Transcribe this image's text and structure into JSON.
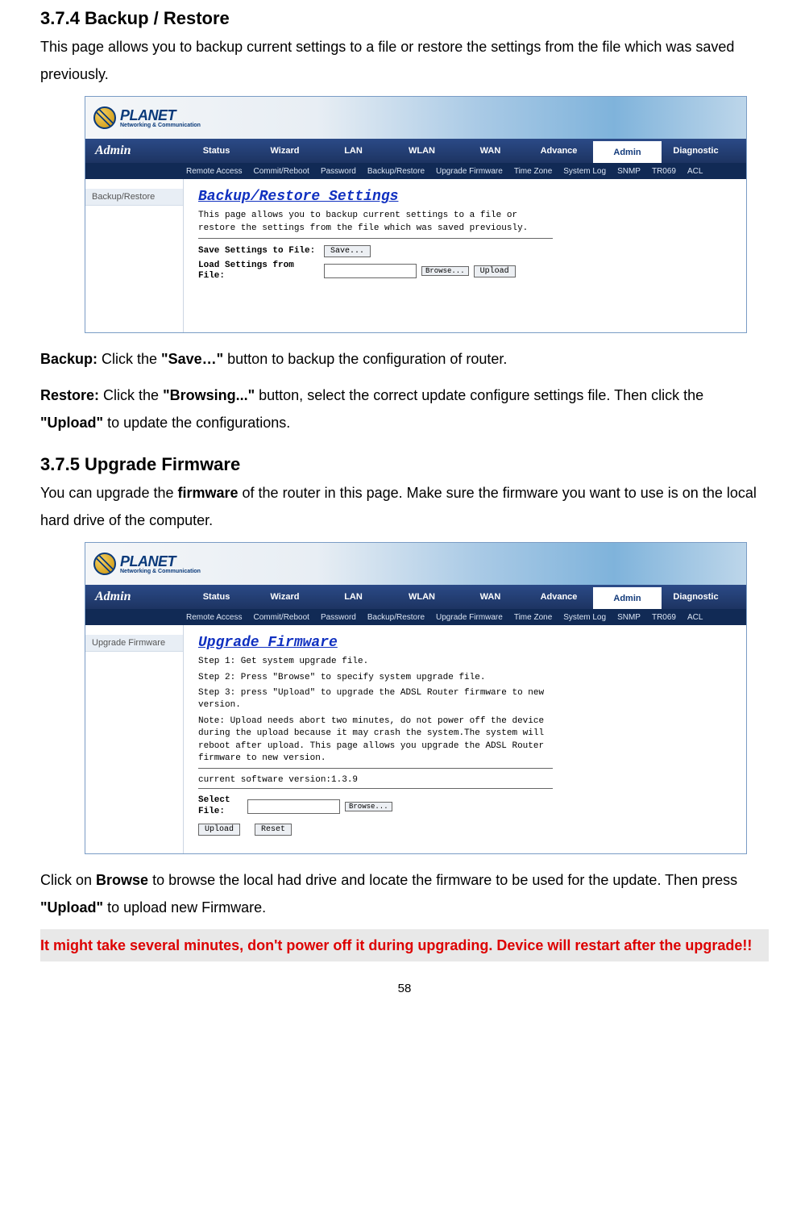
{
  "section1": {
    "heading": "3.7.4 Backup / Restore",
    "intro": "This page allows you to backup current settings to a file or restore the settings from the file which was saved previously.",
    "backup_label": "Backup:",
    "backup_text1": " Click the ",
    "backup_bold": "\"Save…\"",
    "backup_text2": " button to backup the configuration of router.",
    "restore_label": "Restore:",
    "restore_text1": " Click the ",
    "restore_bold1": "\"Browsing...\"",
    "restore_text2": " button, select the correct update configure settings file. Then click the ",
    "restore_bold2": "\"Upload\"",
    "restore_text3": " to update the configurations."
  },
  "section2": {
    "heading": "3.7.5 Upgrade Firmware",
    "intro1": "You can upgrade the ",
    "intro_bold": "firmware",
    "intro2": " of the router in this page. Make sure the firmware you want to use is on the local hard drive of the computer.",
    "outro1": "Click on ",
    "outro_bold1": "Browse",
    "outro2": " to browse the local had drive and locate the firmware to be used for the update. Then press ",
    "outro_bold2": "\"Upload\"",
    "outro3": " to upload new Firmware."
  },
  "warning": "It might take several minutes, don't power off it during upgrading. Device will restart after the upgrade!!",
  "page_number": "58",
  "logo": {
    "name": "PLANET",
    "tagline": "Networking & Communication"
  },
  "nav": {
    "brand": "Admin",
    "tabs": [
      "Status",
      "Wizard",
      "LAN",
      "WLAN",
      "WAN",
      "Advance",
      "Admin",
      "Diagnostic"
    ],
    "sub": [
      "Remote Access",
      "Commit/Reboot",
      "Password",
      "Backup/Restore",
      "Upgrade Firmware",
      "Time Zone",
      "System Log",
      "SNMP",
      "TR069",
      "ACL"
    ]
  },
  "panel1": {
    "sidebar_item": "Backup/Restore",
    "title": "Backup/Restore Settings",
    "desc": "This page allows you to backup current settings to a file or restore the settings from the file which was saved previously.",
    "save_label": "Save Settings to File:",
    "save_btn": "Save...",
    "load_label": "Load Settings from File:",
    "browse_btn": "Browse...",
    "upload_btn": "Upload"
  },
  "panel2": {
    "sidebar_item": "Upgrade Firmware",
    "title": "Upgrade Firmware",
    "step1": "Step 1: Get system upgrade file.",
    "step2": "Step 2: Press \"Browse\" to specify system upgrade file.",
    "step3": "Step 3: press \"Upload\" to upgrade the ADSL Router firmware to new version.",
    "note": "Note: Upload needs abort two minutes, do not power off the device during the upload because it may crash the system.The system will reboot after upload. This page allows you upgrade the ADSL Router firmware to new version.",
    "version": "current software version:1.3.9",
    "select_label": "Select File:",
    "browse_btn": "Browse...",
    "upload_btn": "Upload",
    "reset_btn": "Reset"
  }
}
